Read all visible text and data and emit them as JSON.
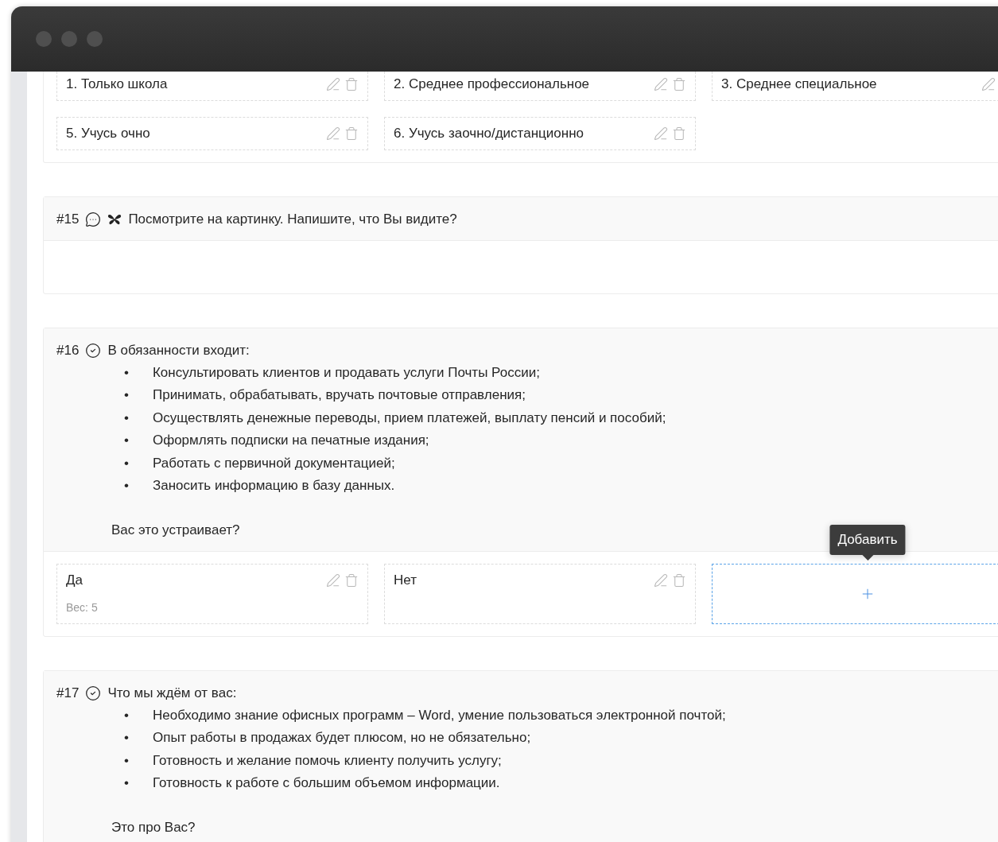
{
  "bullet_marker": "•",
  "questions": [
    {
      "options": [
        {
          "label": "1. Только школа"
        },
        {
          "label": "2. Среднее профессиональное"
        },
        {
          "label": "3. Среднее специальное"
        },
        {
          "label": "5. Учусь очно"
        },
        {
          "label": "6. Учусь заочно/дистанционно"
        }
      ]
    },
    {
      "number": "#15",
      "kind": "text",
      "has_image": true,
      "intro": "Посмотрите на картинку. Напишите, что Вы видите?"
    },
    {
      "number": "#16",
      "kind": "choice",
      "has_image": false,
      "intro": "В обязанности входит:",
      "bullets": [
        "Консультировать клиентов и продавать услуги Почты России;",
        "Принимать, обрабатывать, вручать почтовые отправления;",
        "Осуществлять денежные переводы, прием платежей, выплату пенсий и пособий;",
        "Оформлять подписки на печатные издания;",
        "Работать с первичной документацией;",
        "Заносить информацию в базу данных."
      ],
      "outro": "Вас это устраивает?",
      "options": [
        {
          "label": "Да",
          "weight": "Вес: 5"
        },
        {
          "label": "Нет"
        }
      ],
      "add_tile": {
        "tooltip": "Добавить"
      }
    },
    {
      "number": "#17",
      "kind": "choice",
      "has_image": false,
      "intro": "Что мы ждём от вас:",
      "bullets": [
        "Необходимо знание офисных программ – Word, умение пользоваться электронной почтой;",
        "Опыт работы в продажах будет плюсом, но не обязательно;",
        "Готовность и желание помочь клиенту получить услугу;",
        "Готовность к работе с большим объемом информации."
      ],
      "outro": "Это про Вас?"
    }
  ]
}
